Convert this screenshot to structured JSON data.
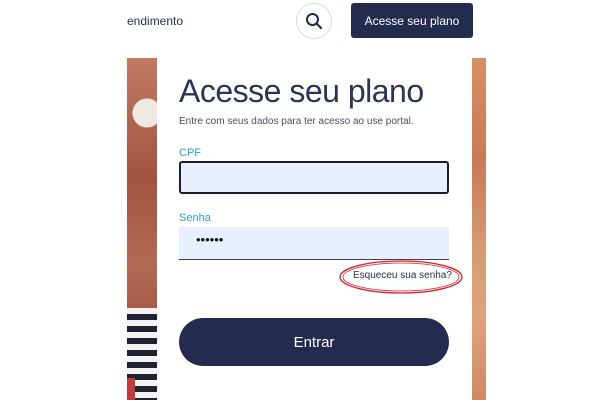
{
  "header": {
    "nav_link": "endimento",
    "search_icon": "search-icon",
    "cta_label": "Acesse seu plano"
  },
  "login": {
    "title": "Acesse seu plano",
    "subtitle": "Entre com seus dados para ter acesso ao use portal.",
    "cpf_label": "CPF",
    "cpf_value": "",
    "password_label": "Senha",
    "password_value": "••••••",
    "forgot_link": "Esqueceu sua senha?",
    "submit_label": "Entrar"
  },
  "colors": {
    "primary_navy": "#232b4f",
    "label_blue": "#2e9bd6",
    "input_bg": "#e8efff",
    "annotation_red": "#d8232a"
  }
}
